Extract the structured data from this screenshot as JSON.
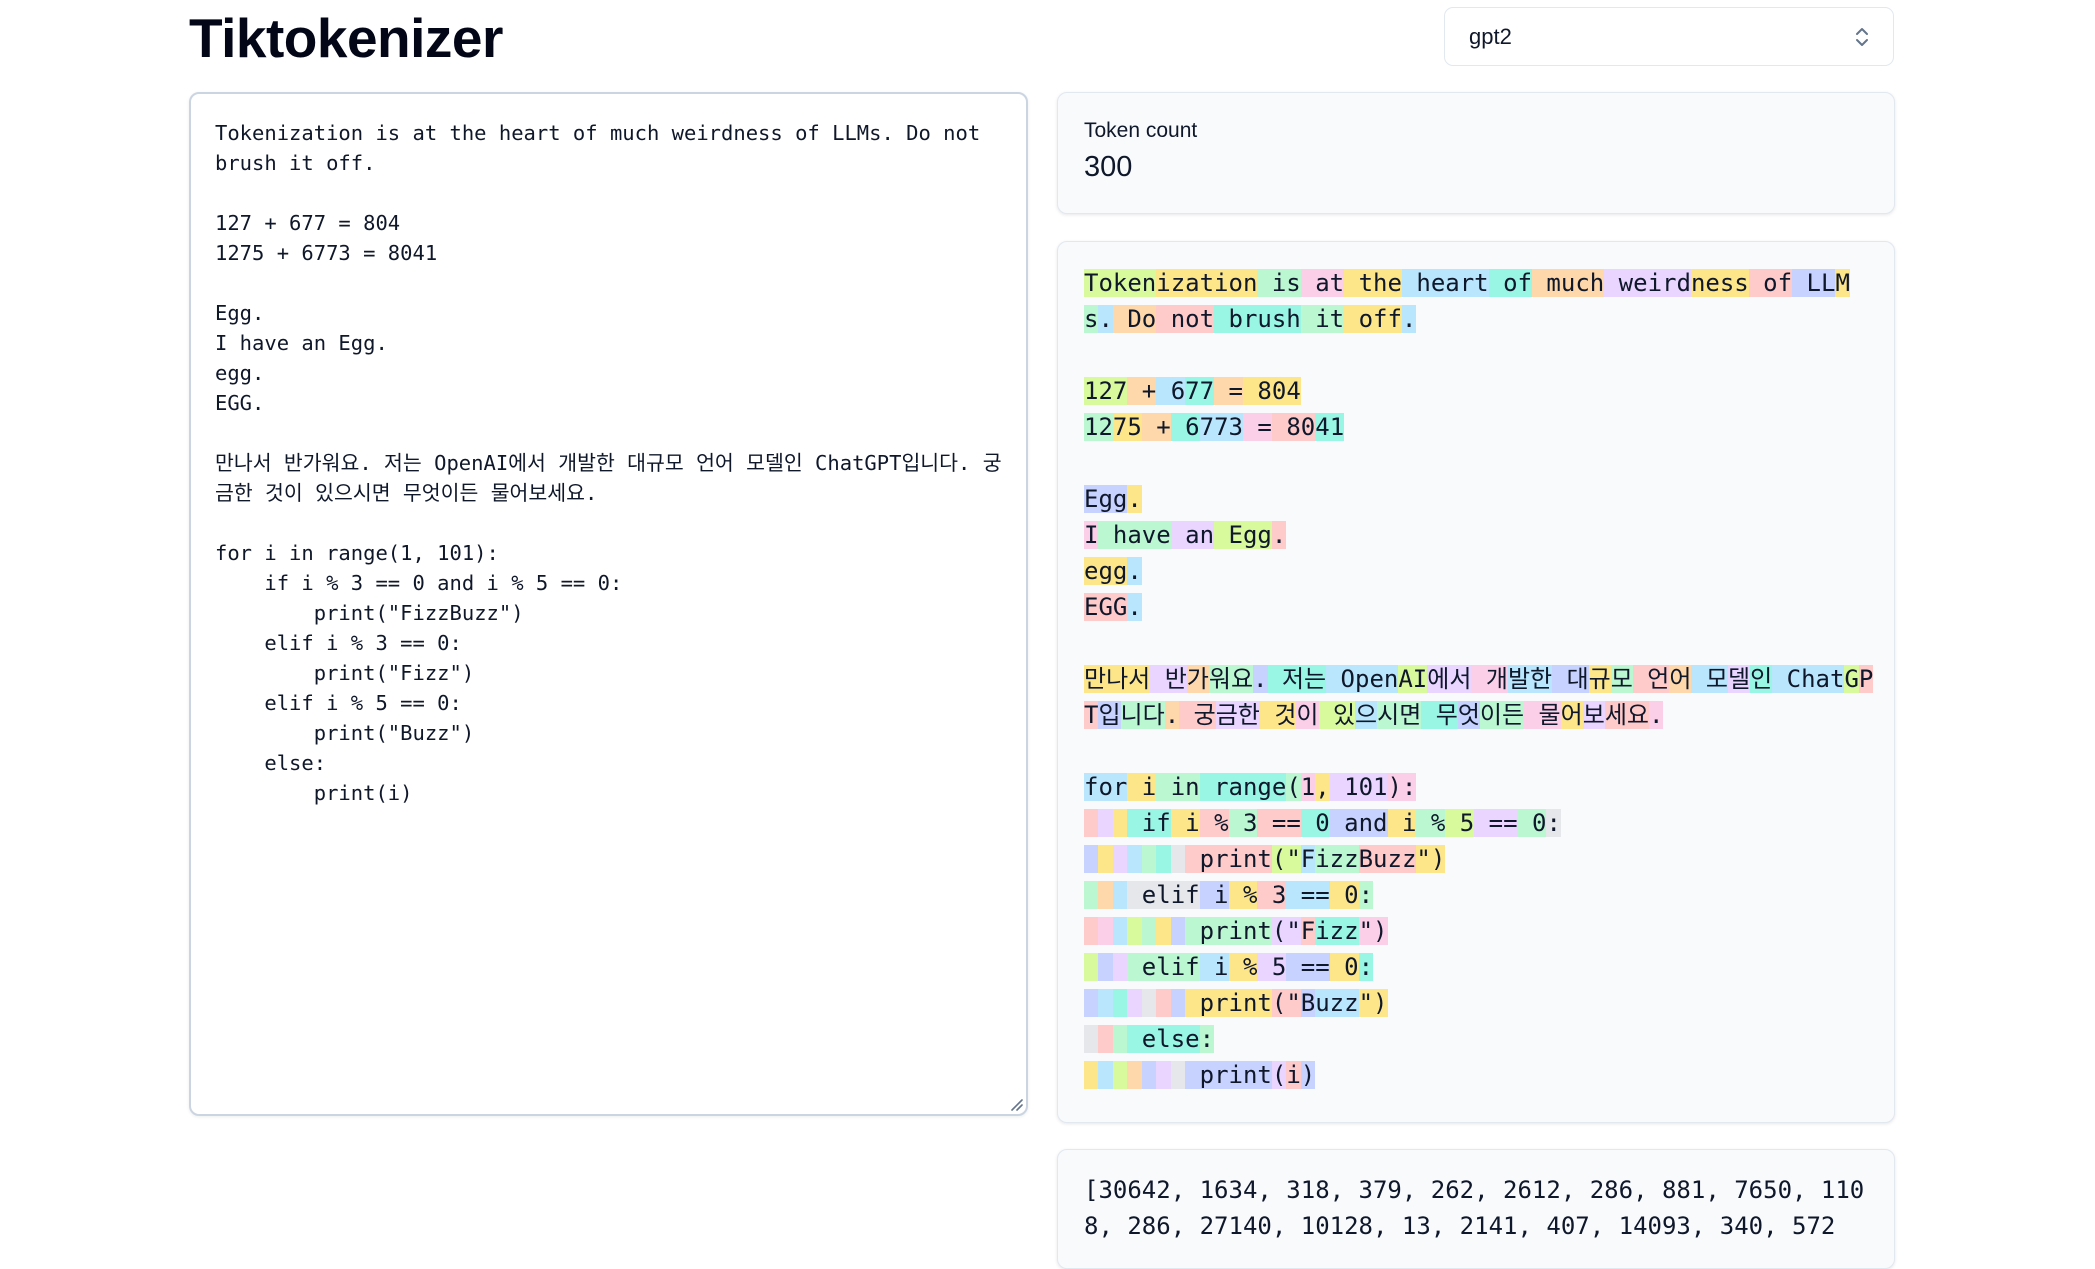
{
  "app": {
    "title": "Tiktokenizer"
  },
  "model_select": {
    "value": "gpt2"
  },
  "input": {
    "text": "Tokenization is at the heart of much weirdness of LLMs. Do not brush it off.\n\n127 + 677 = 804\n1275 + 6773 = 8041\n\nEgg.\nI have an Egg.\negg.\nEGG.\n\n만나서 반가워요. 저는 OpenAI에서 개발한 대규모 언어 모델인 ChatGPT입니다. 궁금한 것이 있으시면 무엇이든 물어보세요.\n\nfor i in range(1, 101):\n    if i % 3 == 0 and i % 5 == 0:\n        print(\"FizzBuzz\")\n    elif i % 3 == 0:\n        print(\"Fizz\")\n    elif i % 5 == 0:\n        print(\"Buzz\")\n    else:\n        print(i)"
  },
  "token_count": {
    "label": "Token count",
    "value": "300"
  },
  "token_colors": [
    "#c7d2fe",
    "#fde68a",
    "#bbf7d0",
    "#fecaca",
    "#bae6fd",
    "#e9d5ff",
    "#fbcfe8",
    "#99f6e4",
    "#d9f99d",
    "#fed7aa",
    "#e5e7eb"
  ],
  "tokens": [
    [
      "Token",
      "i"
    ],
    [
      "ization",
      "b"
    ],
    [
      " is",
      "c"
    ],
    [
      " at",
      "g"
    ],
    [
      " the",
      "b"
    ],
    [
      " heart",
      "e"
    ],
    [
      " of",
      "h"
    ],
    [
      " much",
      "j"
    ],
    [
      " weird",
      "f"
    ],
    [
      "ness",
      "b"
    ],
    [
      " of",
      "d"
    ],
    [
      " LL",
      "a"
    ],
    [
      "M",
      "b"
    ],
    [
      "s",
      "c"
    ],
    [
      ".",
      "e"
    ],
    [
      " Do",
      "j"
    ],
    [
      " not",
      "d"
    ],
    [
      " brush",
      "h"
    ],
    [
      " it",
      "c"
    ],
    [
      " off",
      "b"
    ],
    [
      ".",
      "e"
    ],
    [
      "\n\n",
      "_"
    ],
    [
      "127",
      "i"
    ],
    [
      " +",
      "j"
    ],
    [
      " 6",
      "e"
    ],
    [
      "77",
      "h"
    ],
    [
      " =",
      "j"
    ],
    [
      " 804",
      "b"
    ],
    [
      "\n",
      "_"
    ],
    [
      "12",
      "c"
    ],
    [
      "75",
      "b"
    ],
    [
      " +",
      "j"
    ],
    [
      " 6",
      "h"
    ],
    [
      "773",
      "e"
    ],
    [
      " =",
      "g"
    ],
    [
      " 80",
      "d"
    ],
    [
      "41",
      "h"
    ],
    [
      "\n\n",
      "_"
    ],
    [
      "Egg",
      "a"
    ],
    [
      ".",
      "b"
    ],
    [
      "\n",
      "_"
    ],
    [
      "I",
      "g"
    ],
    [
      " have",
      "c"
    ],
    [
      " an",
      "f"
    ],
    [
      " Egg",
      "i"
    ],
    [
      ".",
      "d"
    ],
    [
      "\n",
      "_"
    ],
    [
      "egg",
      "b"
    ],
    [
      ".",
      "e"
    ],
    [
      "\n",
      "_"
    ],
    [
      "EGG",
      "d"
    ],
    [
      ".",
      "e"
    ],
    [
      "\n\n",
      "_"
    ],
    [
      "만나서",
      "b"
    ],
    [
      " 반",
      "f"
    ],
    [
      "가",
      "j"
    ],
    [
      "워요",
      "c"
    ],
    [
      ".",
      "a"
    ],
    [
      " 저는",
      "h"
    ],
    [
      " Open",
      "e"
    ],
    [
      "AI",
      "i"
    ],
    [
      "에서",
      "f"
    ],
    [
      " 개",
      "g"
    ],
    [
      "발한",
      "e"
    ],
    [
      " 대",
      "a"
    ],
    [
      "규",
      "b"
    ],
    [
      "모",
      "c"
    ],
    [
      " 언",
      "d"
    ],
    [
      "어",
      "j"
    ],
    [
      " 모",
      "e"
    ],
    [
      "델",
      "f"
    ],
    [
      "인",
      "h"
    ],
    [
      " Chat",
      "e"
    ],
    [
      "G",
      "i"
    ],
    [
      "PT",
      "d"
    ],
    [
      "입",
      "a"
    ],
    [
      "니다",
      "c"
    ],
    [
      ".",
      "j"
    ],
    [
      " 궁",
      "d"
    ],
    [
      "금한",
      "f"
    ],
    [
      " 것",
      "b"
    ],
    [
      "이",
      "g"
    ],
    [
      " 있",
      "i"
    ],
    [
      "으",
      "e"
    ],
    [
      "시면",
      "c"
    ],
    [
      " 무",
      "h"
    ],
    [
      "엇",
      "a"
    ],
    [
      "이든",
      "c"
    ],
    [
      " 물",
      "g"
    ],
    [
      "어",
      "b"
    ],
    [
      "보",
      "f"
    ],
    [
      "세요",
      "d"
    ],
    [
      ".",
      "g"
    ],
    [
      "\n\n",
      "_"
    ],
    [
      "for",
      "e"
    ],
    [
      " i",
      "b"
    ],
    [
      " in",
      "c"
    ],
    [
      " range",
      "h"
    ],
    [
      "(",
      "c"
    ],
    [
      "1",
      "g"
    ],
    [
      ",",
      "b"
    ],
    [
      " 101",
      "f"
    ],
    [
      "):",
      "g"
    ],
    [
      "\n",
      "_"
    ],
    [
      " ",
      "d"
    ],
    [
      " ",
      "f"
    ],
    [
      " ",
      "b"
    ],
    [
      " if",
      "h"
    ],
    [
      " i",
      "b"
    ],
    [
      " %",
      "d"
    ],
    [
      " 3",
      "c"
    ],
    [
      " ==",
      "d"
    ],
    [
      " 0",
      "h"
    ],
    [
      " and",
      "a"
    ],
    [
      " i",
      "b"
    ],
    [
      " %",
      "c"
    ],
    [
      " 5",
      "i"
    ],
    [
      " ==",
      "f"
    ],
    [
      " 0",
      "c"
    ],
    [
      ":",
      "k"
    ],
    [
      "\n",
      "_"
    ],
    [
      " ",
      "a"
    ],
    [
      " ",
      "b"
    ],
    [
      " ",
      "f"
    ],
    [
      " ",
      "e"
    ],
    [
      " ",
      "c"
    ],
    [
      " ",
      "h"
    ],
    [
      " ",
      "k"
    ],
    [
      " print",
      "d"
    ],
    [
      "(\"",
      "i"
    ],
    [
      "F",
      "e"
    ],
    [
      "izz",
      "c"
    ],
    [
      "Buzz",
      "d"
    ],
    [
      "\")",
      "b"
    ],
    [
      "\n",
      "_"
    ],
    [
      " ",
      "c"
    ],
    [
      " ",
      "j"
    ],
    [
      " ",
      "e"
    ],
    [
      " elif",
      "k"
    ],
    [
      " i",
      "a"
    ],
    [
      " %",
      "b"
    ],
    [
      " 3",
      "d"
    ],
    [
      " ==",
      "e"
    ],
    [
      " 0",
      "b"
    ],
    [
      ":",
      "c"
    ],
    [
      "\n",
      "_"
    ],
    [
      " ",
      "d"
    ],
    [
      " ",
      "g"
    ],
    [
      " ",
      "e"
    ],
    [
      " ",
      "i"
    ],
    [
      " ",
      "c"
    ],
    [
      " ",
      "b"
    ],
    [
      " ",
      "a"
    ],
    [
      " print",
      "c"
    ],
    [
      "(\"",
      "f"
    ],
    [
      "F",
      "d"
    ],
    [
      "izz",
      "h"
    ],
    [
      "\")",
      "g"
    ],
    [
      "\n",
      "_"
    ],
    [
      " ",
      "i"
    ],
    [
      " ",
      "a"
    ],
    [
      " ",
      "f"
    ],
    [
      " elif",
      "c"
    ],
    [
      " i",
      "e"
    ],
    [
      " %",
      "b"
    ],
    [
      " 5",
      "f"
    ],
    [
      " ==",
      "a"
    ],
    [
      " 0",
      "b"
    ],
    [
      ":",
      "h"
    ],
    [
      "\n",
      "_"
    ],
    [
      " ",
      "a"
    ],
    [
      " ",
      "e"
    ],
    [
      " ",
      "h"
    ],
    [
      " ",
      "f"
    ],
    [
      " ",
      "k"
    ],
    [
      " ",
      "d"
    ],
    [
      " ",
      "a"
    ],
    [
      " print",
      "b"
    ],
    [
      "(\"",
      "d"
    ],
    [
      "B",
      "a"
    ],
    [
      "uzz",
      "e"
    ],
    [
      "\")",
      "b"
    ],
    [
      "\n",
      "_"
    ],
    [
      " ",
      "k"
    ],
    [
      " ",
      "d"
    ],
    [
      " ",
      "c"
    ],
    [
      " else",
      "h"
    ],
    [
      ":",
      "c"
    ],
    [
      "\n",
      "_"
    ],
    [
      " ",
      "b"
    ],
    [
      " ",
      "e"
    ],
    [
      " ",
      "i"
    ],
    [
      " ",
      "j"
    ],
    [
      " ",
      "a"
    ],
    [
      " ",
      "f"
    ],
    [
      " ",
      "k"
    ],
    [
      " print",
      "a"
    ],
    [
      "(",
      "f"
    ],
    [
      "i",
      "d"
    ],
    [
      ")",
      "a"
    ]
  ],
  "token_ids": "[30642, 1634, 318, 379, 262, 2612, 286, 881, 7650, 1108, 286, 27140, 10128, 13, 2141, 407, 14093, 340, 572"
}
